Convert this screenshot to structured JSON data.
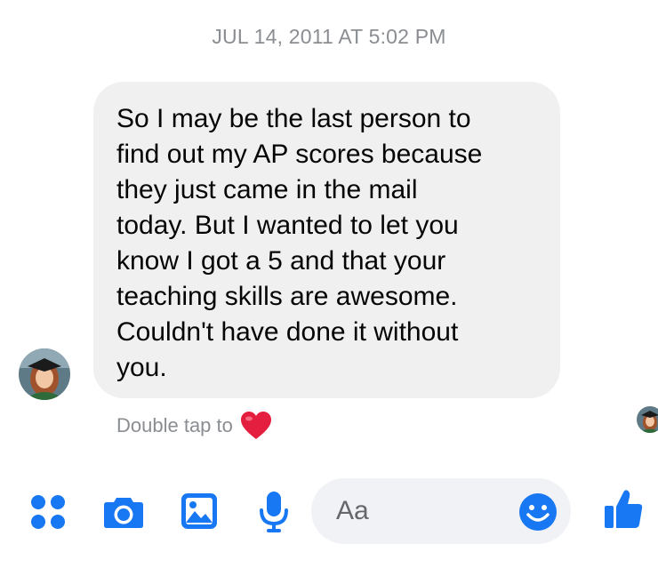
{
  "timestamp": "JUL 14, 2011 AT 5:02 PM",
  "message": {
    "lines": [
      "So I may be the last person to",
      "find out my AP scores because",
      "they just came in the mail",
      "today. But I wanted to let you",
      "know I got a 5 and that your",
      "teaching skills are awesome.",
      "Couldn't have done it without",
      "you."
    ]
  },
  "hint": {
    "text": "Double tap to",
    "icon": "heart-icon"
  },
  "composer": {
    "placeholder": "Aa",
    "icons": [
      "apps-icon",
      "camera-icon",
      "photo-icon",
      "microphone-icon",
      "emoji-icon",
      "thumbs-up-icon"
    ]
  },
  "colors": {
    "accent": "#1877f2",
    "bubble": "#f0f0f1",
    "input": "#f0f2f5",
    "heart": "#e41e3f",
    "muted": "#8a8d91"
  }
}
